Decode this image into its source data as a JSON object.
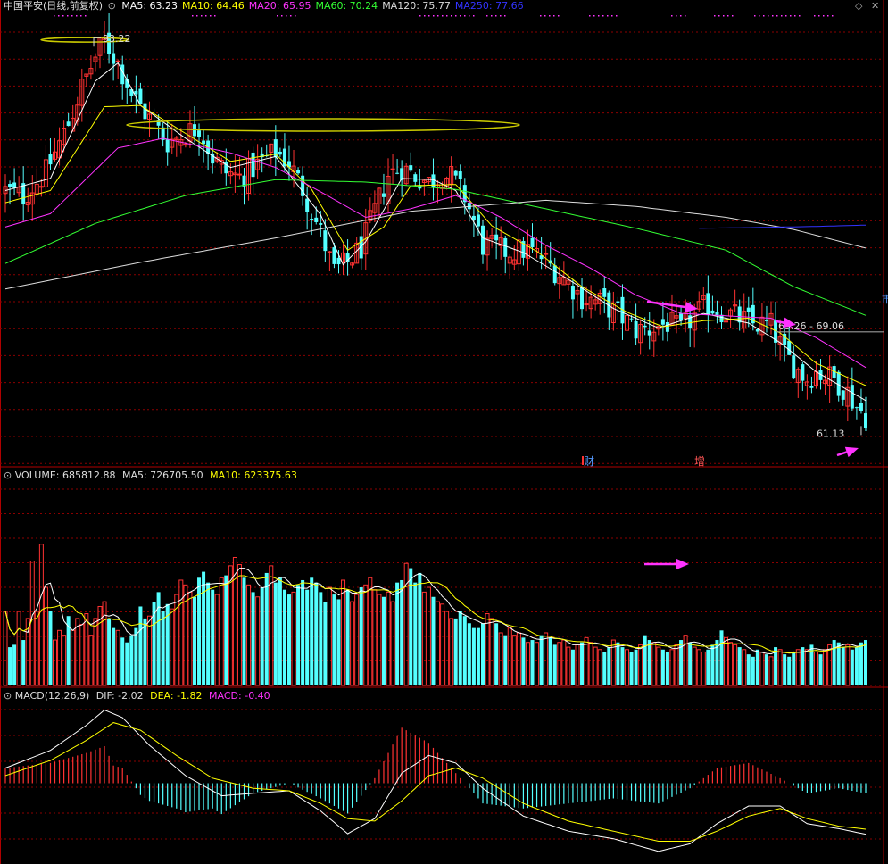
{
  "header": {
    "title": "中国平安(日线,前复权)",
    "ma": [
      {
        "label": "MA5: 63.23",
        "color": "#ffffff"
      },
      {
        "label": "MA10: 64.46",
        "color": "#ffff00"
      },
      {
        "label": "MA20: 65.95",
        "color": "#ff33ff"
      },
      {
        "label": "MA60: 70.24",
        "color": "#33ff33"
      },
      {
        "label": "MA120: 75.77",
        "color": "#dddddd"
      },
      {
        "label": "MA250: 77.66",
        "color": "#3333ff"
      }
    ]
  },
  "volume_header": {
    "title": "VOLUME: 685812.88",
    "ma5": "MA5: 726705.50",
    "ma10": "MA10: 623375.63"
  },
  "macd_header": {
    "title": "MACD(12,26,9)",
    "dif": "DIF: -2.02",
    "dea": "DEA: -1.82",
    "macd": "MACD: -0.40"
  },
  "annotations": {
    "high_label": "93.22",
    "low_label": "61.13",
    "range_label": "69.26 - 69.06",
    "event_cai": "财",
    "event_zeng": "增",
    "edge_mark": "市"
  },
  "colors": {
    "up": "#ff3232",
    "down": "#54ffff",
    "grid": "#8b0000",
    "ma5": "#ffffff",
    "ma10": "#ffff00",
    "ma20": "#ff33ff",
    "ma60": "#33ff33",
    "ma120": "#dddddd",
    "ma250": "#3333ff",
    "arrow": "#ff33ff",
    "ellipse": "#cccc00"
  },
  "chart_data": [
    {
      "type": "candlestick",
      "title": "中国平安(日线,前复权)",
      "ylim": [
        58,
        95
      ],
      "high": 93.22,
      "low": 61.13,
      "price_path": [
        [
          0,
          80.5
        ],
        [
          4,
          80
        ],
        [
          9,
          82
        ],
        [
          14,
          86
        ],
        [
          17,
          89
        ],
        [
          20,
          91.5
        ],
        [
          22,
          92.8
        ],
        [
          25,
          91
        ],
        [
          28,
          88.5
        ],
        [
          32,
          86.4
        ],
        [
          36,
          84.5
        ],
        [
          40,
          85.2
        ],
        [
          43,
          85.8
        ],
        [
          46,
          83.2
        ],
        [
          49,
          82
        ],
        [
          52,
          81.6
        ],
        [
          56,
          82.6
        ],
        [
          60,
          83.7
        ],
        [
          63,
          82.8
        ],
        [
          66,
          80.6
        ],
        [
          70,
          77
        ],
        [
          73,
          73.8
        ],
        [
          76,
          74.6
        ],
        [
          79,
          75.8
        ],
        [
          82,
          78.8
        ],
        [
          85,
          81.8
        ],
        [
          88,
          82.4
        ],
        [
          91,
          81.7
        ],
        [
          94,
          81.2
        ],
        [
          97,
          81.8
        ],
        [
          99,
          81.6
        ],
        [
          102,
          80
        ],
        [
          106,
          76
        ],
        [
          111,
          75.5
        ],
        [
          116,
          75.6
        ],
        [
          119,
          75
        ],
        [
          124,
          73.3
        ],
        [
          128,
          71.7
        ],
        [
          132,
          71.3
        ],
        [
          136,
          70.4
        ],
        [
          140,
          69
        ],
        [
          143,
          69.1
        ],
        [
          147,
          69.6
        ],
        [
          150,
          69
        ],
        [
          153,
          70.2
        ],
        [
          156,
          71.1
        ],
        [
          160,
          70.4
        ],
        [
          163,
          70
        ],
        [
          166,
          69.5
        ],
        [
          170,
          69.4
        ],
        [
          173,
          67
        ],
        [
          176,
          65.7
        ],
        [
          178,
          65
        ],
        [
          180,
          65.6
        ],
        [
          184,
          65
        ],
        [
          187,
          63.9
        ],
        [
          189,
          62.7
        ],
        [
          191,
          62
        ]
      ],
      "n_days": 192,
      "ma": {
        "MA5": [
          [
            0,
            80.5
          ],
          [
            10,
            81.5
          ],
          [
            20,
            89.5
          ],
          [
            25,
            91
          ],
          [
            30,
            87.5
          ],
          [
            40,
            84.8
          ],
          [
            50,
            82.4
          ],
          [
            60,
            83.3
          ],
          [
            70,
            78.5
          ],
          [
            75,
            74.4
          ],
          [
            80,
            76.3
          ],
          [
            88,
            81.5
          ],
          [
            95,
            81.4
          ],
          [
            100,
            80.5
          ],
          [
            106,
            76.6
          ],
          [
            115,
            75.4
          ],
          [
            125,
            73.2
          ],
          [
            135,
            70.8
          ],
          [
            145,
            69.2
          ],
          [
            155,
            70.4
          ],
          [
            165,
            69.6
          ],
          [
            172,
            68
          ],
          [
            180,
            65.6
          ],
          [
            191,
            63.23
          ]
        ],
        "MA10": [
          [
            0,
            79.5
          ],
          [
            10,
            80.5
          ],
          [
            22,
            87.4
          ],
          [
            30,
            87.5
          ],
          [
            40,
            85.2
          ],
          [
            50,
            82.9
          ],
          [
            60,
            83.5
          ],
          [
            68,
            80.6
          ],
          [
            76,
            75.6
          ],
          [
            84,
            77.5
          ],
          [
            90,
            80.9
          ],
          [
            100,
            81
          ],
          [
            108,
            77.6
          ],
          [
            118,
            75.5
          ],
          [
            128,
            72.6
          ],
          [
            138,
            70.5
          ],
          [
            146,
            69.3
          ],
          [
            155,
            69.8
          ],
          [
            165,
            70
          ],
          [
            172,
            68.8
          ],
          [
            180,
            66.3
          ],
          [
            191,
            64.46
          ]
        ],
        "MA20": [
          [
            0,
            77.5
          ],
          [
            10,
            78.6
          ],
          [
            25,
            84
          ],
          [
            35,
            84.8
          ],
          [
            50,
            83.6
          ],
          [
            60,
            82.4
          ],
          [
            70,
            80.4
          ],
          [
            80,
            78.3
          ],
          [
            90,
            79
          ],
          [
            100,
            80.1
          ],
          [
            110,
            78.3
          ],
          [
            120,
            76
          ],
          [
            130,
            74.1
          ],
          [
            140,
            71.9
          ],
          [
            150,
            70.4
          ],
          [
            160,
            70.2
          ],
          [
            170,
            70
          ],
          [
            180,
            68.4
          ],
          [
            191,
            65.95
          ]
        ],
        "MA60": [
          [
            0,
            74.5
          ],
          [
            20,
            77.8
          ],
          [
            40,
            80.1
          ],
          [
            60,
            81.4
          ],
          [
            80,
            81.2
          ],
          [
            100,
            80.6
          ],
          [
            120,
            79
          ],
          [
            140,
            77.4
          ],
          [
            160,
            75.6
          ],
          [
            175,
            72.6
          ],
          [
            191,
            70.24
          ]
        ],
        "MA120": [
          [
            0,
            72.4
          ],
          [
            30,
            74.6
          ],
          [
            60,
            76.6
          ],
          [
            90,
            78.8
          ],
          [
            120,
            79.7
          ],
          [
            140,
            79.2
          ],
          [
            160,
            78.3
          ],
          [
            175,
            77.3
          ],
          [
            191,
            75.77
          ]
        ],
        "MA250": [
          [
            154,
            77.4
          ],
          [
            165,
            77.45
          ],
          [
            180,
            77.55
          ],
          [
            191,
            77.66
          ]
        ]
      }
    },
    {
      "type": "bar",
      "title": "VOLUME",
      "ylim": [
        0,
        1700000
      ],
      "values": [
        620000,
        320000,
        340000,
        620000,
        380000,
        560000,
        1040000,
        620000,
        1180000,
        820000,
        620000,
        380000,
        460000,
        420000,
        580000,
        460000,
        560000,
        510000,
        600000,
        420000,
        560000,
        660000,
        700000,
        560000,
        480000,
        460000,
        400000,
        360000,
        420000,
        480000,
        660000,
        560000,
        580000,
        700000,
        780000,
        620000,
        680000,
        640000,
        760000,
        880000,
        840000,
        780000,
        740000,
        900000,
        950000,
        860000,
        800000,
        760000,
        900000,
        920000,
        1000000,
        1070000,
        1010000,
        900000,
        840000,
        780000,
        740000,
        820000,
        940000,
        1000000,
        860000,
        900000,
        800000,
        760000,
        780000,
        840000,
        880000,
        800000,
        900000,
        860000,
        780000,
        700000,
        820000,
        760000,
        720000,
        880000,
        800000,
        700000,
        760000,
        820000,
        840000,
        900000,
        800000,
        760000,
        740000,
        780000,
        700000,
        860000,
        880000,
        1020000,
        980000,
        860000,
        940000,
        780000,
        820000,
        740000,
        700000,
        680000,
        620000,
        560000,
        560000,
        620000,
        580000,
        520000,
        480000,
        480000,
        520000,
        600000,
        560000,
        520000,
        440000,
        420000,
        480000,
        420000,
        440000,
        400000,
        360000,
        380000,
        360000,
        420000,
        440000,
        400000,
        340000,
        360000,
        380000,
        320000,
        300000,
        340000,
        360000,
        400000,
        360000,
        320000,
        300000,
        280000,
        320000,
        380000,
        360000,
        320000,
        300000,
        280000,
        300000,
        340000,
        420000,
        380000,
        360000,
        320000,
        300000,
        280000,
        300000,
        340000,
        380000,
        420000,
        360000,
        320000,
        300000,
        280000,
        300000,
        340000,
        380000,
        460000,
        400000,
        360000,
        340000,
        320000,
        300000,
        260000,
        240000,
        300000,
        280000,
        260000,
        240000,
        320000,
        300000,
        260000,
        240000,
        280000,
        300000,
        320000,
        300000,
        340000,
        280000,
        260000,
        300000,
        340000,
        380000,
        360000,
        320000,
        340000,
        300000,
        320000,
        360000,
        380000,
        420000,
        685812
      ],
      "notes": "approximate daily volume read from bar heights",
      "ma5_last": 726705.5,
      "ma10_last": 623375.63
    },
    {
      "type": "bar",
      "title": "MACD(12,26,9)",
      "ylim": [
        -3.2,
        3.2
      ],
      "dif_path": [
        [
          0,
          0.6
        ],
        [
          10,
          1.3
        ],
        [
          18,
          2.3
        ],
        [
          22,
          2.9
        ],
        [
          26,
          2.6
        ],
        [
          32,
          1.5
        ],
        [
          40,
          0.3
        ],
        [
          48,
          -0.5
        ],
        [
          55,
          -0.4
        ],
        [
          63,
          -0.3
        ],
        [
          70,
          -1.1
        ],
        [
          76,
          -2.0
        ],
        [
          82,
          -1.4
        ],
        [
          88,
          0.4
        ],
        [
          94,
          1.1
        ],
        [
          100,
          0.8
        ],
        [
          106,
          -0.2
        ],
        [
          115,
          -1.3
        ],
        [
          125,
          -1.9
        ],
        [
          135,
          -2.2
        ],
        [
          145,
          -2.7
        ],
        [
          152,
          -2.4
        ],
        [
          158,
          -1.6
        ],
        [
          165,
          -0.9
        ],
        [
          172,
          -0.9
        ],
        [
          178,
          -1.6
        ],
        [
          185,
          -1.8
        ],
        [
          191,
          -2.02
        ]
      ],
      "dea_path": [
        [
          0,
          0.3
        ],
        [
          10,
          0.9
        ],
        [
          18,
          1.7
        ],
        [
          24,
          2.4
        ],
        [
          30,
          2.1
        ],
        [
          38,
          1.1
        ],
        [
          46,
          0.2
        ],
        [
          55,
          -0.2
        ],
        [
          63,
          -0.3
        ],
        [
          70,
          -0.8
        ],
        [
          76,
          -1.4
        ],
        [
          82,
          -1.5
        ],
        [
          88,
          -0.7
        ],
        [
          94,
          0.3
        ],
        [
          100,
          0.6
        ],
        [
          106,
          0.2
        ],
        [
          115,
          -0.8
        ],
        [
          125,
          -1.5
        ],
        [
          135,
          -1.9
        ],
        [
          145,
          -2.3
        ],
        [
          152,
          -2.3
        ],
        [
          158,
          -1.9
        ],
        [
          165,
          -1.3
        ],
        [
          172,
          -1.0
        ],
        [
          178,
          -1.4
        ],
        [
          185,
          -1.7
        ],
        [
          191,
          -1.82
        ]
      ],
      "dif": -2.02,
      "dea": -1.82,
      "macd": -0.4
    }
  ]
}
